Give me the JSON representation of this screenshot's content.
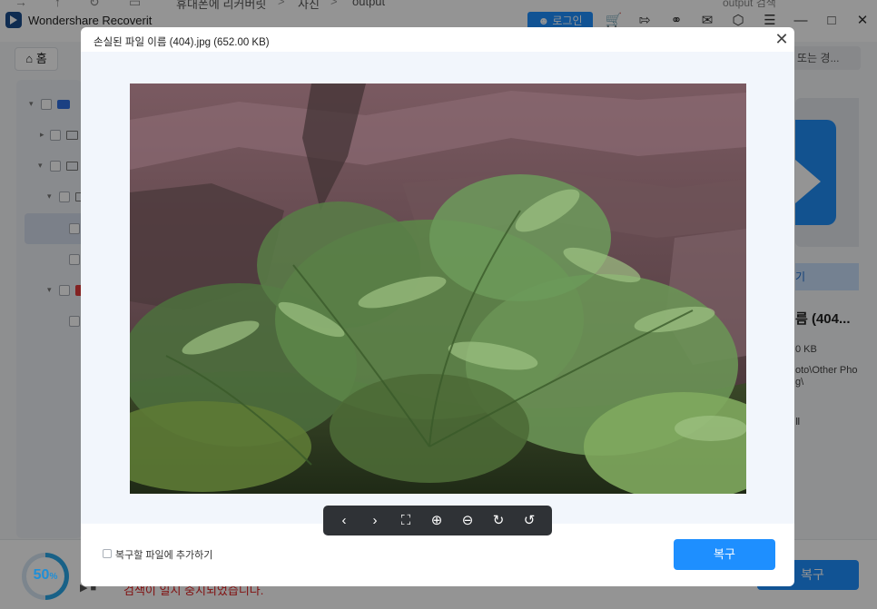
{
  "app": {
    "title": "Wondershare Recoverit",
    "breadcrumb": [
      "휴대폰에 리커버릿",
      "사진",
      "output"
    ],
    "search_top": "output 검색",
    "login_label": "로그인",
    "home_label": "홈",
    "search_placeholder": "또는 경...",
    "preview_label": "기",
    "side_name": "름 (404...",
    "side_size": "0 KB",
    "side_path_1": "oto\\Other Pho",
    "side_path_2": "g\\",
    "side_extra": "Ⅱ",
    "progress_value": "50",
    "progress_unit": "%",
    "progress_fraction": 0.5,
    "status_text": "검색이 일시 중지되었습니다.",
    "bg_recover_label": "복구"
  },
  "modal": {
    "title": "손실된 파일 이름 (404).jpg (652.00 KB)",
    "add_to_recover_label": "복구할 파일에 추가하기",
    "recover_label": "복구",
    "viewer_controls": [
      "previous-icon",
      "next-icon",
      "fullscreen-icon",
      "zoom-in-icon",
      "zoom-out-icon",
      "rotate-right-icon",
      "rotate-left-icon"
    ]
  },
  "colors": {
    "accent": "#1e8fff",
    "status_red": "#e02020",
    "progress": "#2aa7e8"
  }
}
